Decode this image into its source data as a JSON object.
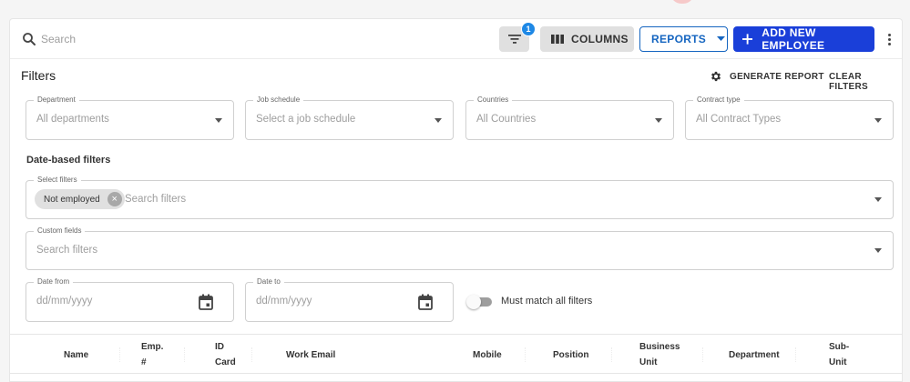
{
  "toolbar": {
    "search_placeholder": "Search",
    "filter_badge_count": "1",
    "columns_label": "COLUMNS",
    "reports_label": "REPORTS",
    "add_label": "ADD NEW EMPLOYEE",
    "accent_color": "#1a3fd9"
  },
  "filters": {
    "title": "Filters",
    "generate_report_label": "GENERATE REPORT",
    "clear_filters_label": "CLEAR FILTERS",
    "department": {
      "label": "Department",
      "value": "All departments"
    },
    "job_schedule": {
      "label": "Job schedule",
      "value": "Select a job schedule"
    },
    "countries": {
      "label": "Countries",
      "value": "All Countries"
    },
    "contract_type": {
      "label": "Contract type",
      "value": "All Contract Types"
    }
  },
  "date_filters": {
    "title": "Date-based filters",
    "select_filters": {
      "label": "Select filters",
      "chip": "Not employed",
      "placeholder": "Search filters"
    },
    "custom_fields": {
      "label": "Custom fields",
      "placeholder": "Search filters"
    },
    "date_from": {
      "label": "Date from",
      "placeholder": "dd/mm/yyyy"
    },
    "date_to": {
      "label": "Date to",
      "placeholder": "dd/mm/yyyy"
    },
    "match_all_label": "Must match all filters",
    "match_all_enabled": false
  },
  "table": {
    "columns": [
      {
        "line1": "Name",
        "line2": ""
      },
      {
        "line1": "Emp.",
        "line2": "#"
      },
      {
        "line1": "ID",
        "line2": "Card"
      },
      {
        "line1": "Work Email",
        "line2": ""
      },
      {
        "line1": "Mobile",
        "line2": ""
      },
      {
        "line1": "Position",
        "line2": ""
      },
      {
        "line1": "Business",
        "line2": "Unit"
      },
      {
        "line1": "Department",
        "line2": ""
      },
      {
        "line1": "Sub-",
        "line2": "Unit"
      }
    ]
  },
  "icons": [
    "search-icon",
    "filter-list-icon",
    "columns-icon",
    "chevron-down-icon",
    "plus-icon",
    "more-vert-icon",
    "gear-icon",
    "close-icon",
    "calendar-icon"
  ]
}
